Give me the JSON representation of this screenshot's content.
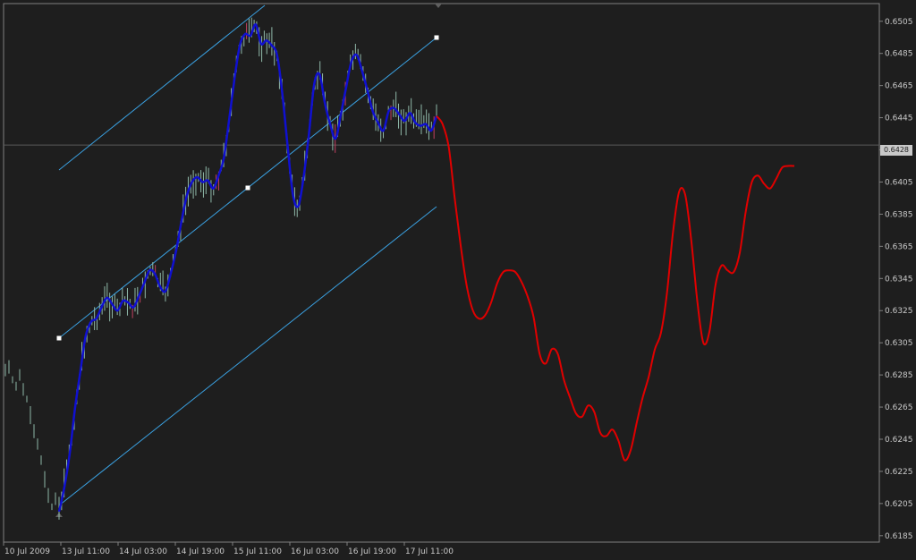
{
  "chart_data": {
    "type": "line",
    "title": "",
    "xlabel": "",
    "ylabel": "",
    "x_tick_labels": [
      "10 Jul 2009",
      "13 Jul 11:00",
      "14 Jul 03:00",
      "14 Jul 19:00",
      "15 Jul 11:00",
      "16 Jul 03:00",
      "16 Jul 19:00",
      "17 Jul 11:00"
    ],
    "y_tick_labels": [
      "0.6505",
      "0.6485",
      "0.6465",
      "0.6445",
      "0.6425",
      "0.6405",
      "0.6385",
      "0.6365",
      "0.6345",
      "0.6325",
      "0.6305",
      "0.6285",
      "0.6265",
      "0.6245",
      "0.6225",
      "0.6205",
      "0.6185"
    ],
    "ylim": [
      0.6181,
      0.6516
    ],
    "current_price_label": "0.6428",
    "current_price": 0.6428,
    "grid": false,
    "colors": {
      "background": "#1e1e1e",
      "bars": "#8fb8a8",
      "bars_down": "#c04060",
      "moving_average": "#1010d0",
      "forecast": "#e00000",
      "channel": "#3aa0e0",
      "axis": "#808080",
      "text": "#c8c8c8"
    },
    "series": [
      {
        "values": [
          0.62,
          0.6215,
          0.6236,
          0.6264,
          0.6287,
          0.6309,
          0.6318,
          0.632,
          0.6327,
          0.6333,
          0.6329,
          0.6325,
          0.6331,
          0.633,
          0.6327,
          0.6334,
          0.6342,
          0.635,
          0.6348,
          0.634,
          0.6337,
          0.6348,
          0.6362,
          0.638,
          0.6396,
          0.6405,
          0.6408,
          0.6405,
          0.6406,
          0.6401,
          0.6409,
          0.642,
          0.6444,
          0.6469,
          0.649,
          0.6497,
          0.6496,
          0.6503,
          0.6491,
          0.6493,
          0.649,
          0.6484,
          0.646,
          0.6427,
          0.6397,
          0.639,
          0.6408,
          0.6435,
          0.6466,
          0.6472,
          0.6454,
          0.6441,
          0.6432,
          0.6447,
          0.6464,
          0.648,
          0.6484,
          0.6474,
          0.6462,
          0.6449,
          0.6442,
          0.6437,
          0.6449,
          0.6451,
          0.6447,
          0.6443,
          0.6448,
          0.6442,
          0.644,
          0.6441,
          0.6437,
          0.6446
        ]
      },
      {
        "values": [
          0.6446,
          0.6441,
          0.6427,
          0.6395,
          0.6365,
          0.634,
          0.6325,
          0.632,
          0.6322,
          0.633,
          0.6342,
          0.6349,
          0.635,
          0.6349,
          0.6343,
          0.6334,
          0.6321,
          0.6298,
          0.6292,
          0.6301,
          0.6298,
          0.6282,
          0.6271,
          0.6261,
          0.6259,
          0.6266,
          0.6262,
          0.6249,
          0.6247,
          0.6251,
          0.6244,
          0.6232,
          0.6238,
          0.6255,
          0.6271,
          0.6284,
          0.6301,
          0.6311,
          0.6336,
          0.6374,
          0.6399,
          0.6397,
          0.6369,
          0.6331,
          0.6305,
          0.6312,
          0.6341,
          0.6353,
          0.635,
          0.6349,
          0.6361,
          0.6387,
          0.6405,
          0.6409,
          0.6404,
          0.6401,
          0.6407,
          0.6414,
          0.6415,
          0.6415
        ]
      }
    ]
  }
}
